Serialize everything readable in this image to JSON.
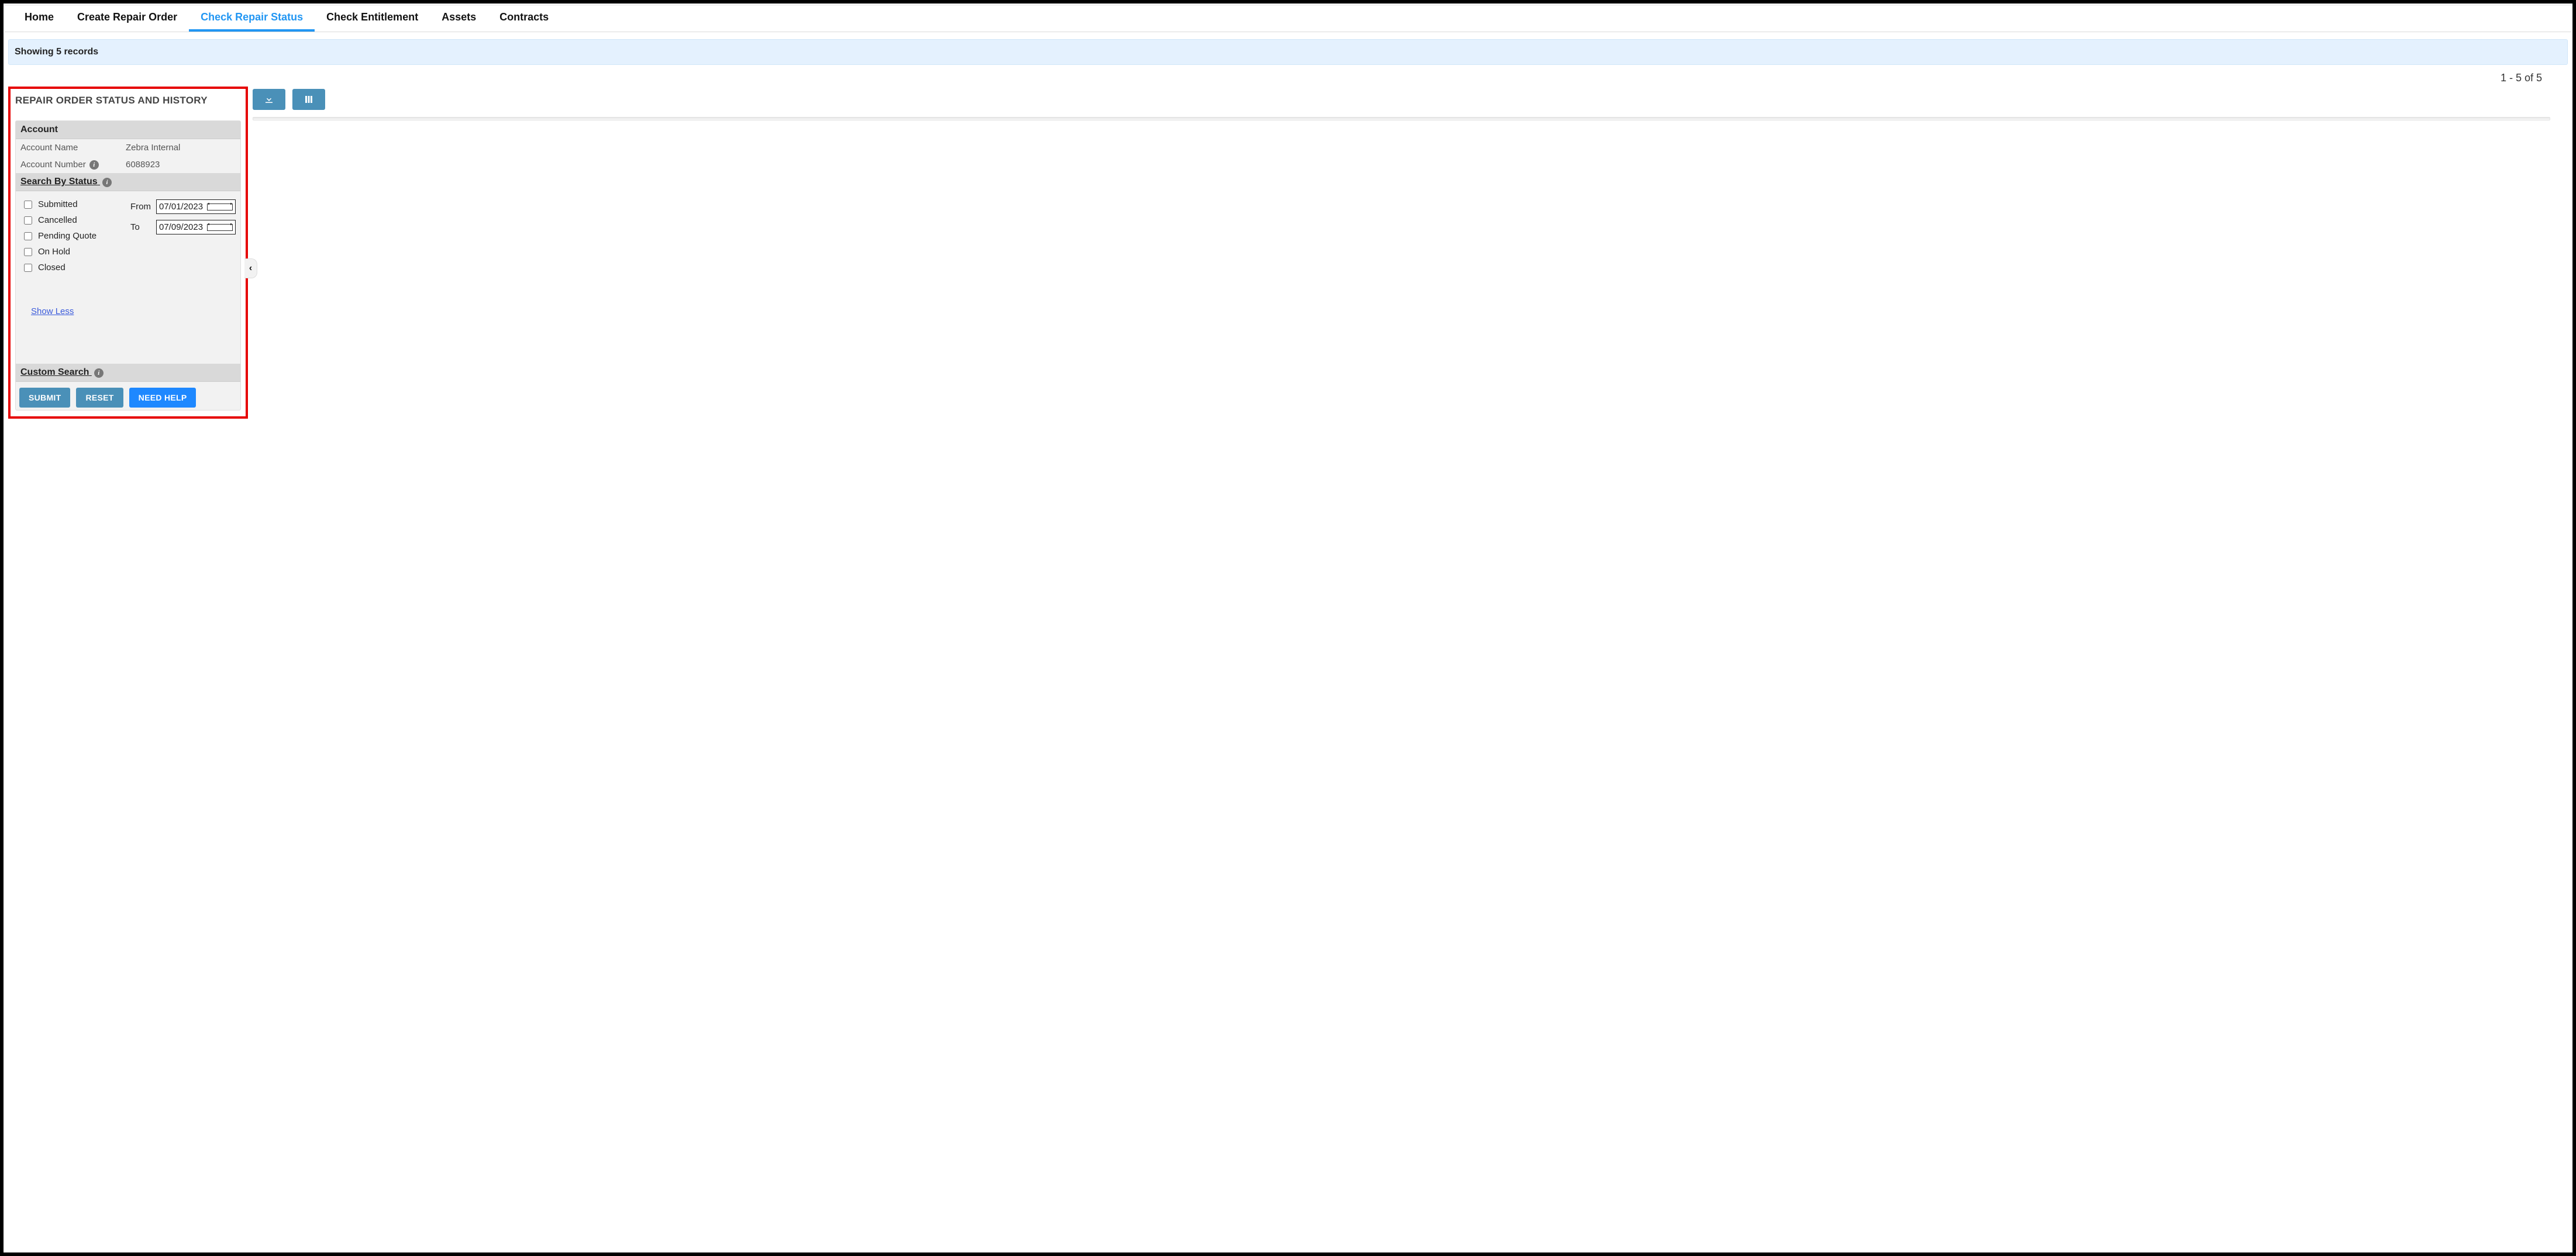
{
  "nav": {
    "tabs": [
      {
        "label": "Home",
        "active": false
      },
      {
        "label": "Create Repair Order",
        "active": false
      },
      {
        "label": "Check Repair Status",
        "active": true
      },
      {
        "label": "Check Entitlement",
        "active": false
      },
      {
        "label": "Assets",
        "active": false
      },
      {
        "label": "Contracts",
        "active": false
      }
    ]
  },
  "status_bar": "Showing 5 records",
  "pagination": "1 - 5 of 5",
  "panel": {
    "title": "REPAIR ORDER STATUS AND HISTORY",
    "account_header": "Account",
    "account_name_label": "Account Name",
    "account_name_value": "Zebra Internal",
    "account_number_label": "Account Number",
    "account_number_value": "6088923",
    "search_by_status_header": "Search By Status",
    "statuses": [
      "Submitted",
      "Cancelled",
      "Pending Quote",
      "On Hold",
      "Closed"
    ],
    "from_label": "From",
    "to_label": "To",
    "from_value": "07/01/2023",
    "to_value": "07/09/2023",
    "show_less": "Show Less",
    "custom_search_header": "Custom Search",
    "buttons": {
      "submit": "SUBMIT",
      "reset": "RESET",
      "need_help": "NEED HELP"
    }
  }
}
